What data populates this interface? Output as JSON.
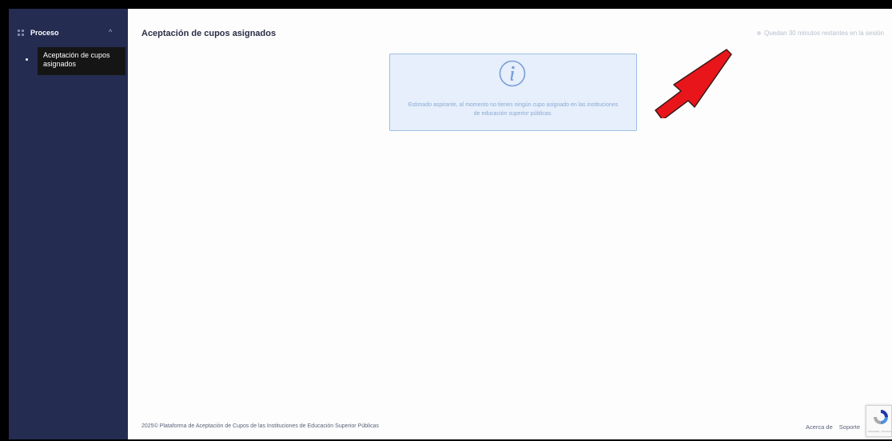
{
  "sidebar": {
    "section_label": "Proceso",
    "items": [
      {
        "label": "Aceptación de cupos asignados",
        "active": true
      }
    ]
  },
  "header": {
    "title": "Aceptación de cupos asignados",
    "session_notice": "Quedan 30 minutos restantes en la sesión"
  },
  "main": {
    "info_message": "Estimado aspirante, al momento no tienes ningún cupo asignado en las instituciones de educación superior públicas."
  },
  "footer": {
    "copyright": "2025© Plataforma de Aceptación de Cupos de las Instituciones de Educación Superior Públicas",
    "links": [
      "Acerca de",
      "Soporte"
    ]
  },
  "recaptcha": {
    "label": "Privacidad - Términos"
  },
  "colors": {
    "sidebar_bg": "#242c51",
    "active_item_bg": "#151515",
    "info_bg": "#e6effb",
    "info_border": "#9fbee5",
    "info_text": "#8aa9d6",
    "annotation_arrow": "#e8161b"
  },
  "icons": {
    "sidebar_section": "grid-icon",
    "sidebar_toggle": "chevron-up-icon",
    "info": "info-icon",
    "session": "clock-icon",
    "captcha": "recaptcha-icon"
  }
}
